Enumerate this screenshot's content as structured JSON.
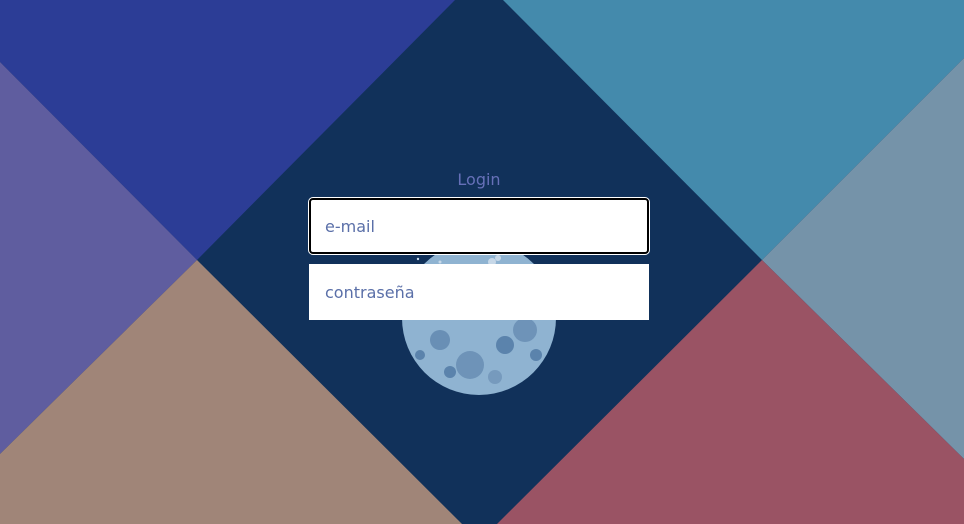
{
  "background": {
    "colors": {
      "top_left": "#2c3d96",
      "top_right": "#448aac",
      "left": "#5f5d9f",
      "right": "#7593a9",
      "bottom_left": "#a08578",
      "bottom_right": "#9a5364",
      "center": "#11315a",
      "moon": "#8fb3d1"
    },
    "moon_icon": "moon-illustration"
  },
  "login": {
    "title": "Login",
    "email_placeholder": "e-mail",
    "password_placeholder": "contraseña"
  }
}
